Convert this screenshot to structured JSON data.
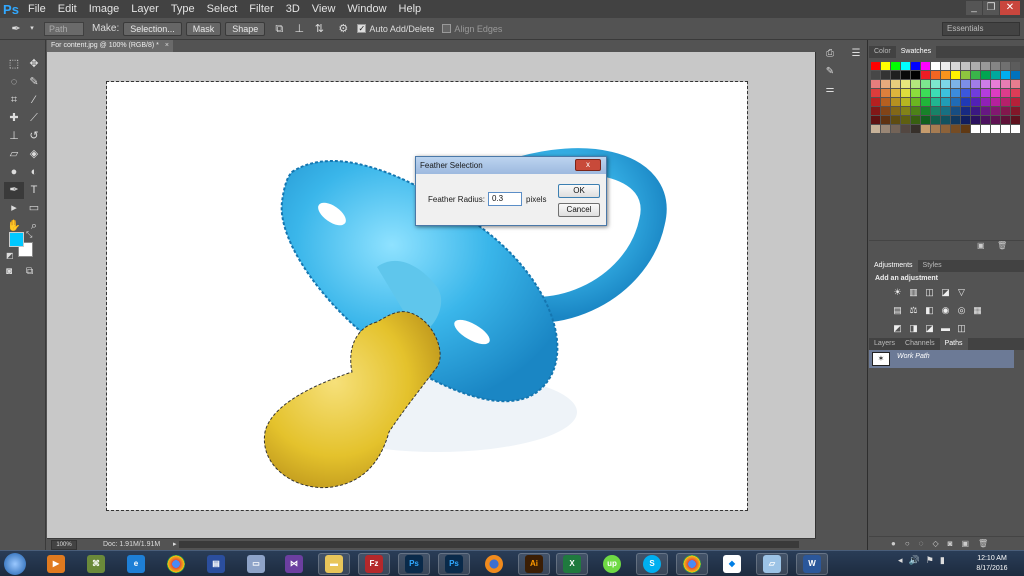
{
  "app": {
    "logo": "Ps",
    "title": "Adobe Photoshop"
  },
  "menu": [
    "File",
    "Edit",
    "Image",
    "Layer",
    "Type",
    "Select",
    "Filter",
    "3D",
    "View",
    "Window",
    "Help"
  ],
  "window_controls": {
    "minimize": "_",
    "restore": "❐",
    "close": "✕"
  },
  "options_bar": {
    "tool_icon": "pen-icon",
    "mode_select": "Path",
    "make_label": "Make:",
    "selection_btn": "Selection...",
    "mask_btn": "Mask",
    "shape_btn": "Shape",
    "auto_add_delete": {
      "label": "Auto Add/Delete",
      "checked": true
    },
    "align_edges": {
      "label": "Align Edges",
      "checked": false
    },
    "workspace": "Essentials"
  },
  "document": {
    "tab_title": "For content.jpg @ 100% (RGB/8) *",
    "close": "×"
  },
  "status": {
    "zoom": "100%",
    "doc_info": "Doc: 1.91M/1.91M",
    "arrow": "▸"
  },
  "dialog": {
    "title": "Feather Selection",
    "close": "x",
    "field_label": "Feather Radius:",
    "field_value": "0.3",
    "unit": "pixels",
    "ok": "OK",
    "cancel": "Cancel"
  },
  "panels": {
    "swatch_tabs": [
      "Color",
      "Swatches"
    ],
    "swatch_active": "Swatches",
    "adjust_tabs": [
      "Adjustments",
      "Styles"
    ],
    "adjust_active": "Adjustments",
    "adjust_title": "Add an adjustment",
    "layers_tabs": [
      "Layers",
      "Channels",
      "Paths"
    ],
    "layers_active": "Paths",
    "path_name": "Work Path"
  },
  "taskbar": {
    "clock_time": "12:10 AM",
    "clock_date": "8/17/2016"
  },
  "colors": {
    "foreground": "#00c8ff",
    "background": "#ffffff",
    "accent": "#31a8ff"
  }
}
